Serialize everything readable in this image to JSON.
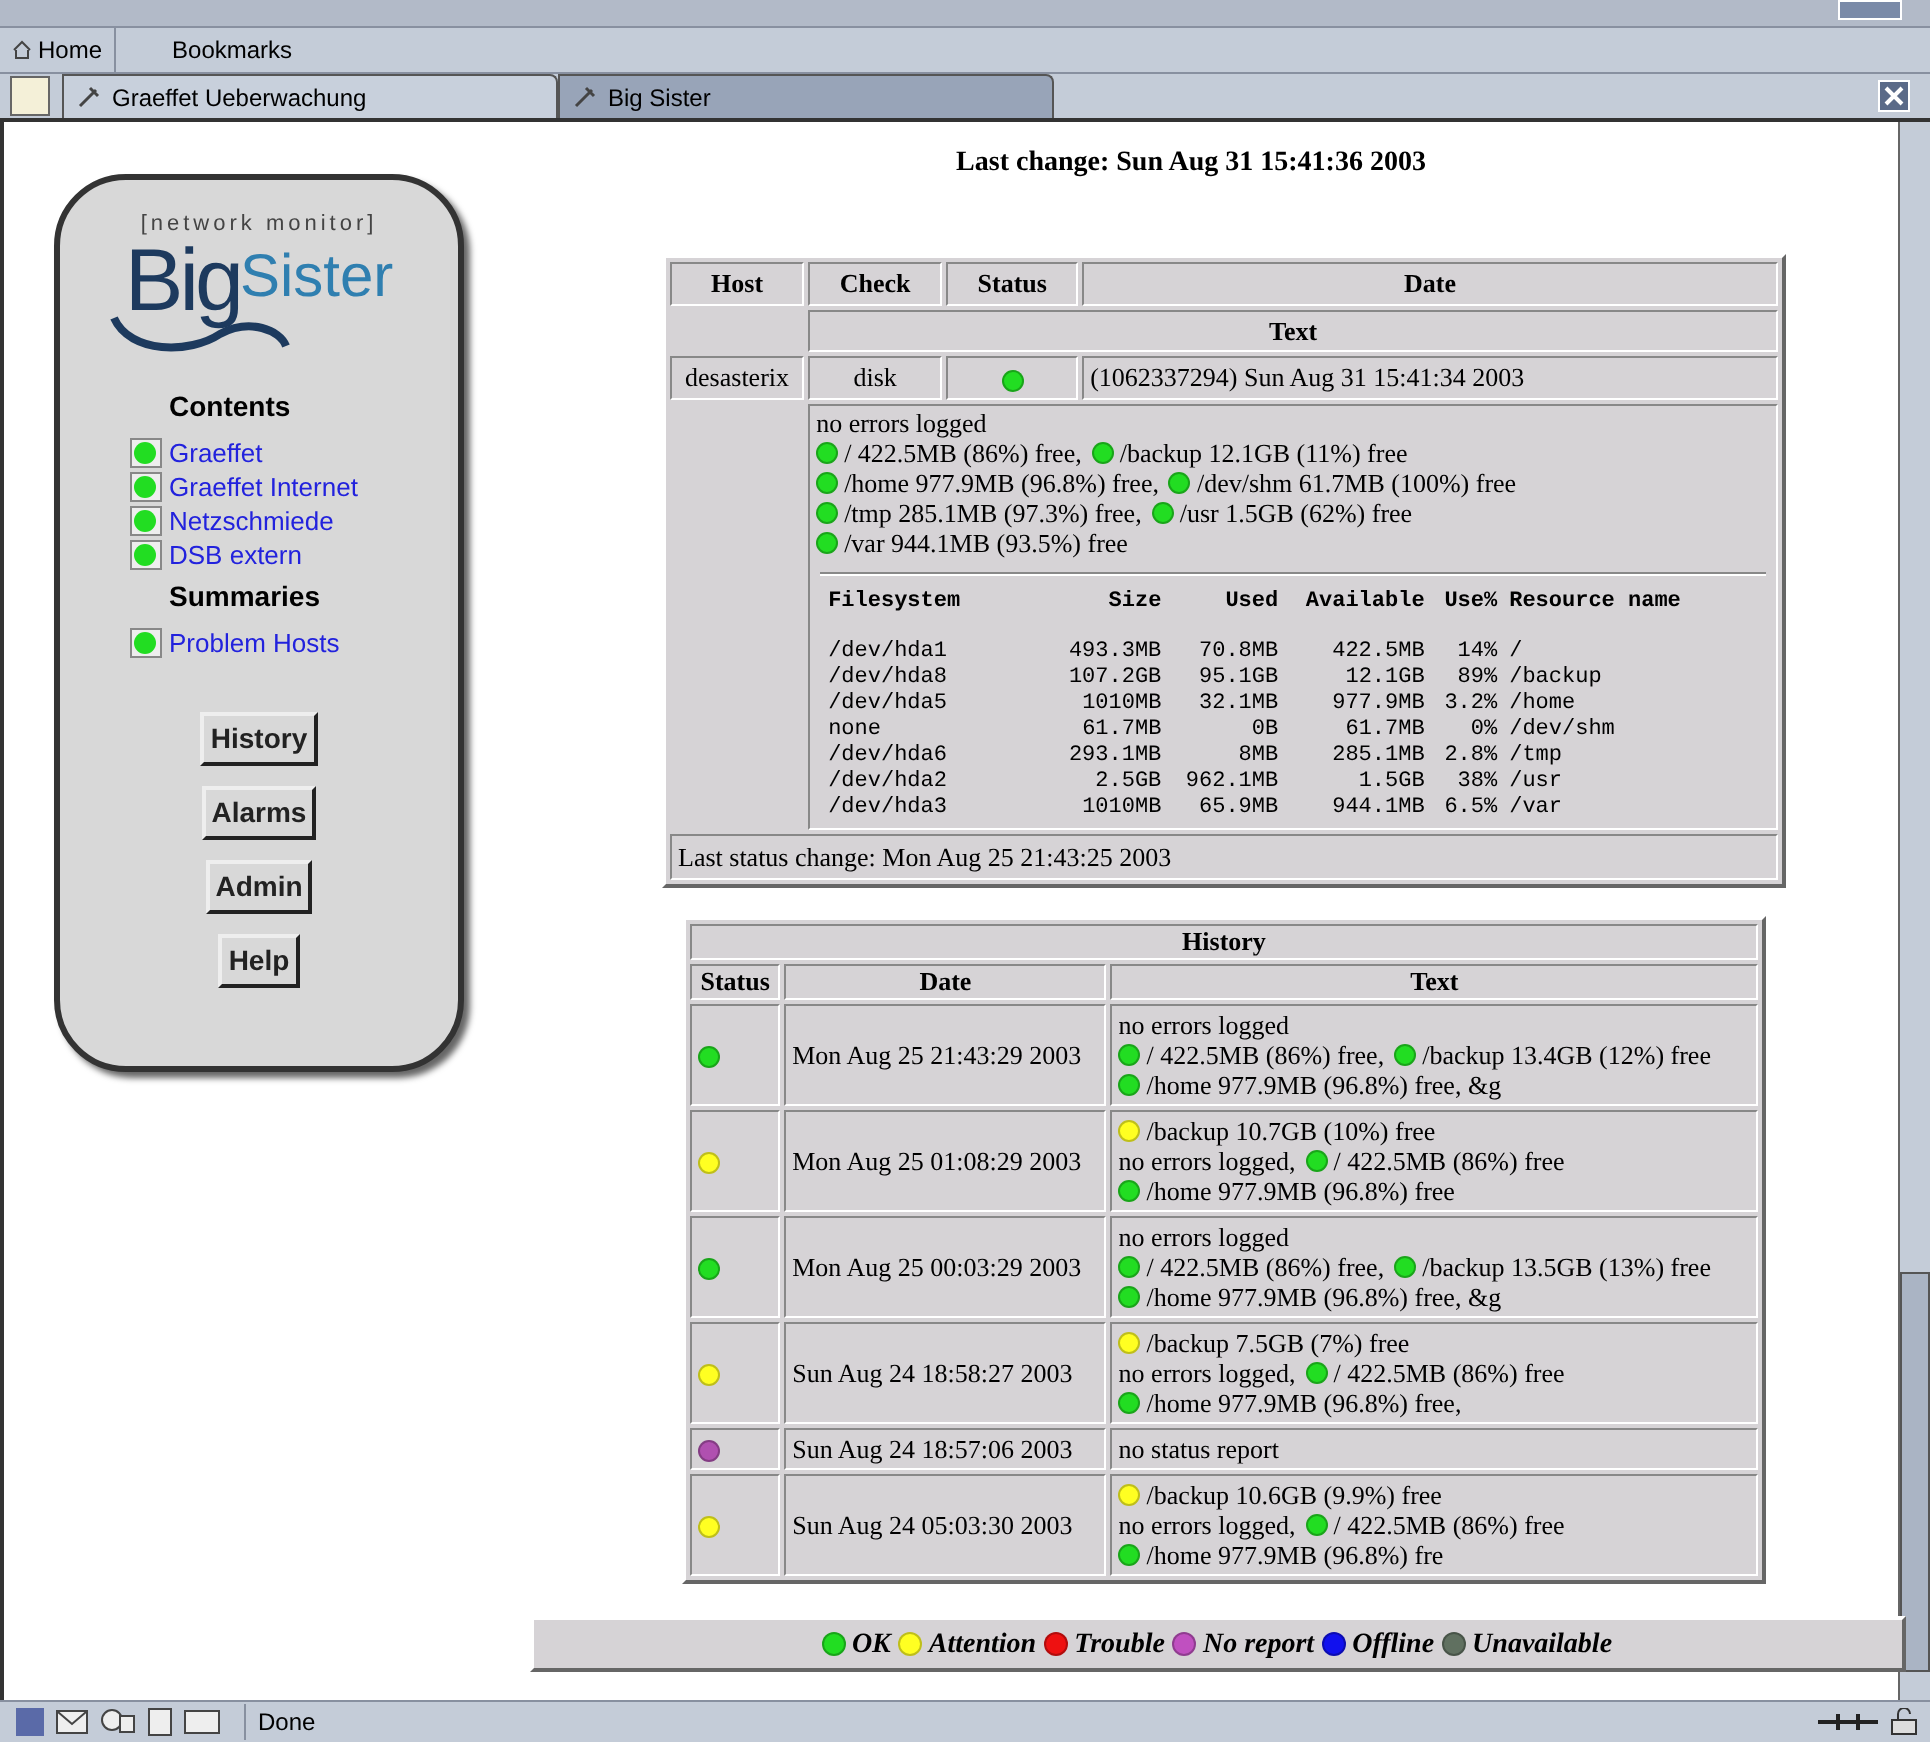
{
  "browser": {
    "menu": [
      {
        "label": "Home"
      },
      {
        "label": "Bookmarks"
      }
    ],
    "tabs": [
      {
        "label": "Graeffet Ueberwachung",
        "selected": true
      },
      {
        "label": "Big Sister",
        "selected": false
      }
    ],
    "status": "Done"
  },
  "sidebar": {
    "logo": {
      "tagline": "[network monitor]",
      "word_1": "Big",
      "word_2": "Sister"
    },
    "sections": [
      {
        "title": "Contents",
        "items": [
          {
            "label": "Graeffet",
            "color": "#22dd22"
          },
          {
            "label": "Graeffet Internet",
            "color": "#22dd22"
          },
          {
            "label": "Netzschmiede",
            "color": "#22dd22"
          },
          {
            "label": "DSB extern",
            "color": "#22dd22"
          }
        ]
      },
      {
        "title": "Summaries",
        "items": [
          {
            "label": "Problem Hosts",
            "color": "#22dd22"
          }
        ]
      }
    ],
    "buttons": [
      "History",
      "Alarms",
      "Admin",
      "Help"
    ]
  },
  "last_change": "Last change: Sun Aug 31 15:41:36 2003",
  "status_table": {
    "columns": [
      "Host",
      "Check",
      "Status",
      "Date"
    ],
    "text_header": "Text",
    "row": {
      "host": "desasterix",
      "check": "disk",
      "color": "#22dd22",
      "date": "(1062337294) Sun Aug 31 15:41:34 2003"
    },
    "lines": [
      [
        {
          "text": "no errors logged"
        }
      ],
      [
        {
          "color": "#22dd22",
          "text": "/ 422.5MB (86%) free,"
        },
        {
          "color": "#22dd22",
          "text": "/backup 12.1GB (11%) free"
        }
      ],
      [
        {
          "color": "#22dd22",
          "text": "/home 977.9MB (96.8%) free,"
        },
        {
          "color": "#22dd22",
          "text": "/dev/shm 61.7MB (100%) free"
        }
      ],
      [
        {
          "color": "#22dd22",
          "text": "/tmp 285.1MB (97.3%) free,"
        },
        {
          "color": "#22dd22",
          "text": "/usr 1.5GB (62%) free"
        }
      ],
      [
        {
          "color": "#22dd22",
          "text": "/var 944.1MB (93.5%) free"
        }
      ]
    ],
    "filesystems": {
      "columns": [
        "Filesystem",
        "Size",
        "Used",
        "Available",
        "Use%",
        "Resource name"
      ],
      "rows": [
        [
          "/dev/hda1",
          "493.3MB",
          "70.8MB",
          "422.5MB",
          "14%",
          "/"
        ],
        [
          "/dev/hda8",
          "107.2GB",
          "95.1GB",
          "12.1GB",
          "89%",
          "/backup"
        ],
        [
          "/dev/hda5",
          "1010MB",
          "32.1MB",
          "977.9MB",
          "3.2%",
          "/home"
        ],
        [
          "none",
          "61.7MB",
          "0B",
          "61.7MB",
          "0%",
          "/dev/shm"
        ],
        [
          "/dev/hda6",
          "293.1MB",
          "8MB",
          "285.1MB",
          "2.8%",
          "/tmp"
        ],
        [
          "/dev/hda2",
          "2.5GB",
          "962.1MB",
          "1.5GB",
          "38%",
          "/usr"
        ],
        [
          "/dev/hda3",
          "1010MB",
          "65.9MB",
          "944.1MB",
          "6.5%",
          "/var"
        ]
      ]
    },
    "footer": "Last status change: Mon Aug 25 21:43:25 2003"
  },
  "history": {
    "title": "History",
    "columns": [
      "Status",
      "Date",
      "Text"
    ],
    "rows": [
      {
        "color": "#22dd22",
        "date": "Mon Aug 25 21:43:29 2003",
        "lines": [
          [
            {
              "text": "no errors logged"
            }
          ],
          [
            {
              "color": "#22dd22",
              "text": "/ 422.5MB (86%) free,"
            },
            {
              "color": "#22dd22",
              "text": "/backup 13.4GB (12%) free"
            }
          ],
          [
            {
              "color": "#22dd22",
              "text": "/home 977.9MB (96.8%) free, &g"
            }
          ]
        ]
      },
      {
        "color": "#ffff22",
        "date": "Mon Aug 25 01:08:29 2003",
        "lines": [
          [
            {
              "color": "#ffff22",
              "text": "/backup 10.7GB (10%) free"
            }
          ],
          [
            {
              "text": "no errors logged,"
            },
            {
              "color": "#22dd22",
              "text": "/ 422.5MB (86%) free"
            }
          ],
          [
            {
              "color": "#22dd22",
              "text": "/home 977.9MB (96.8%) free"
            }
          ]
        ]
      },
      {
        "color": "#22dd22",
        "date": "Mon Aug 25 00:03:29 2003",
        "lines": [
          [
            {
              "text": "no errors logged"
            }
          ],
          [
            {
              "color": "#22dd22",
              "text": "/ 422.5MB (86%) free,"
            },
            {
              "color": "#22dd22",
              "text": "/backup 13.5GB (13%) free"
            }
          ],
          [
            {
              "color": "#22dd22",
              "text": "/home 977.9MB (96.8%) free, &g"
            }
          ]
        ]
      },
      {
        "color": "#ffff22",
        "date": "Sun Aug 24 18:58:27 2003",
        "lines": [
          [
            {
              "color": "#ffff22",
              "text": "/backup 7.5GB (7%) free"
            }
          ],
          [
            {
              "text": "no errors logged,"
            },
            {
              "color": "#22dd22",
              "text": "/ 422.5MB (86%) free"
            }
          ],
          [
            {
              "color": "#22dd22",
              "text": "/home 977.9MB (96.8%) free,"
            }
          ]
        ]
      },
      {
        "color": "#b050b0",
        "date": "Sun Aug 24 18:57:06 2003",
        "lines": [
          [
            {
              "text": "no status report"
            }
          ]
        ]
      },
      {
        "color": "#ffff22",
        "date": "Sun Aug 24 05:03:30 2003",
        "lines": [
          [
            {
              "color": "#ffff22",
              "text": "/backup 10.6GB (9.9%) free"
            }
          ],
          [
            {
              "text": "no errors logged,"
            },
            {
              "color": "#22dd22",
              "text": "/ 422.5MB (86%) free"
            }
          ],
          [
            {
              "color": "#22dd22",
              "text": "/home 977.9MB (96.8%) fre"
            }
          ]
        ]
      }
    ]
  },
  "legend": [
    {
      "label": "OK",
      "color": "#22dd22"
    },
    {
      "label": "Attention",
      "color": "#ffff22"
    },
    {
      "label": "Trouble",
      "color": "#ee1111"
    },
    {
      "label": "No report",
      "color": "#c050c0"
    },
    {
      "label": "Offline",
      "color": "#1111ee"
    },
    {
      "label": "Unavailable",
      "color": "#607060"
    }
  ]
}
